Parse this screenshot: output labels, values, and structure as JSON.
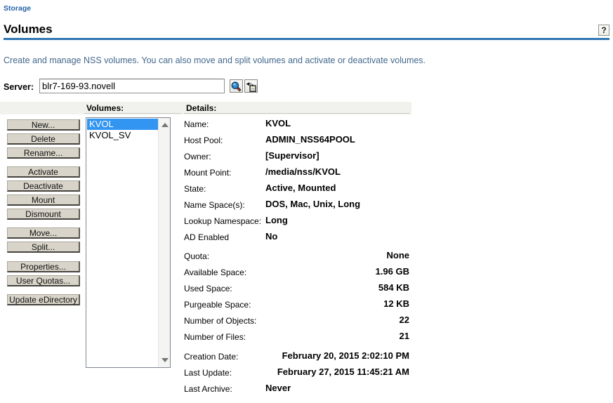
{
  "page": {
    "breadcrumb": "Storage",
    "title": "Volumes",
    "description": "Create and manage NSS volumes. You can also move and split volumes and activate or deactivate volumes.",
    "help_button_label": "?"
  },
  "server": {
    "label": "Server:",
    "value": "blr7-169-93.novell",
    "object_selector_icon": "magnifier-icon",
    "object_history_icon": "history-icon"
  },
  "panel": {
    "volumes_header": "Volumes:",
    "details_header": "Details:"
  },
  "actions": {
    "new": "New...",
    "delete": "Delete",
    "rename": "Rename...",
    "activate": "Activate",
    "deactivate": "Deactivate",
    "mount": "Mount",
    "dismount": "Dismount",
    "move": "Move...",
    "split": "Split...",
    "properties": "Properties...",
    "user_quotas": "User Quotas...",
    "update_edirectory": "Update eDirectory"
  },
  "volumes": {
    "items": [
      {
        "name": "KVOL",
        "selected": true
      },
      {
        "name": "KVOL_SV",
        "selected": false
      }
    ]
  },
  "details": {
    "rows": [
      {
        "label": "Name:",
        "value": "KVOL",
        "align": "left"
      },
      {
        "label": "Host Pool:",
        "value": "ADMIN_NSS64POOL",
        "align": "left"
      },
      {
        "label": "Owner:",
        "value": "[Supervisor]",
        "align": "left"
      },
      {
        "label": "Mount Point:",
        "value": "/media/nss/KVOL",
        "align": "left"
      },
      {
        "label": "State:",
        "value": "Active, Mounted",
        "align": "left"
      },
      {
        "label": "Name Space(s):",
        "value": "DOS, Mac, Unix, Long",
        "align": "left"
      },
      {
        "label": "Lookup Namespace:",
        "value": "Long",
        "align": "left"
      },
      {
        "label": "AD Enabled",
        "value": "No",
        "align": "left"
      },
      {
        "label": "Quota:",
        "value": "None",
        "align": "right"
      },
      {
        "label": "Available Space:",
        "value": "1.96 GB",
        "align": "right"
      },
      {
        "label": "Used Space:",
        "value": "584 KB",
        "align": "right"
      },
      {
        "label": "Purgeable Space:",
        "value": "12 KB",
        "align": "right"
      },
      {
        "label": "Number of Objects:",
        "value": "22",
        "align": "right"
      },
      {
        "label": "Number of Files:",
        "value": "21",
        "align": "right"
      },
      {
        "label": "Creation Date:",
        "value": "February 20, 2015 2:02:10 PM",
        "align": "right"
      },
      {
        "label": "Last Update:",
        "value": "February 27, 2015 11:45:21 AM",
        "align": "right"
      },
      {
        "label": "Last Archive:",
        "value": "Never",
        "align": "left"
      }
    ]
  },
  "colors": {
    "breadcrumb_link": "#2562a8",
    "title_rule": "#2f76b2",
    "description_text": "#44688c",
    "selection_highlight": "#3295f2",
    "panel_band": "#f1f1ee",
    "button_face": "#d8d4c9"
  }
}
